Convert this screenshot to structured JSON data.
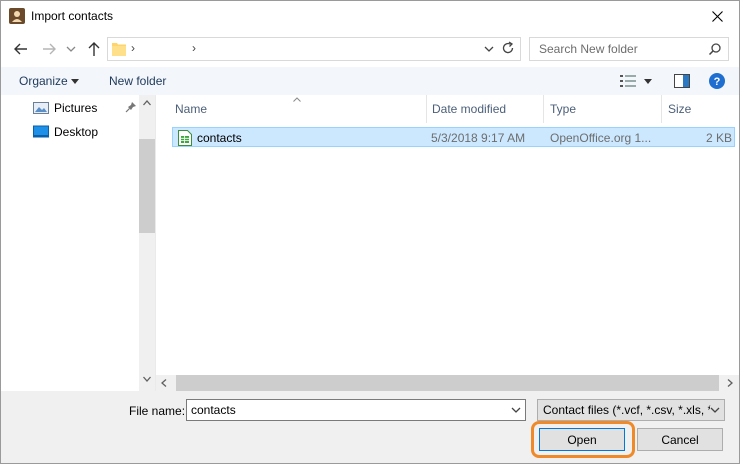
{
  "window": {
    "title": "Import contacts"
  },
  "address": {
    "chevron_1": "›",
    "chevron_2": "›"
  },
  "search": {
    "placeholder": "Search New folder"
  },
  "toolbar": {
    "organize_label": "Organize",
    "new_folder_label": "New folder"
  },
  "sidebar": {
    "items": [
      {
        "label": "Pictures",
        "icon": "pictures-icon",
        "pinned": true
      },
      {
        "label": "Desktop",
        "icon": "desktop-icon"
      }
    ]
  },
  "file_list": {
    "columns": [
      "Name",
      "Date modified",
      "Type",
      "Size"
    ],
    "rows": [
      {
        "name": "contacts",
        "date": "5/3/2018 9:17 AM",
        "type": "OpenOffice.org 1...",
        "size": "2 KB",
        "selected": true
      }
    ]
  },
  "footer": {
    "file_name_label": "File name:",
    "file_name_value": "contacts",
    "filter_label": "Contact files (*.vcf, *.csv, *.xls, *",
    "open_label": "Open",
    "cancel_label": "Cancel"
  },
  "colors": {
    "selection": "#cce8ff",
    "accent": "#0078d7",
    "highlight_ring": "#ef8a2a"
  }
}
